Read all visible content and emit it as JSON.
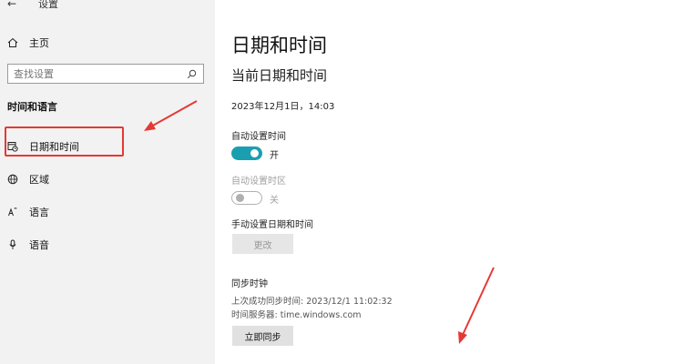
{
  "window": {
    "title": "设置"
  },
  "sidebar": {
    "home_label": "主页",
    "search_placeholder": "查找设置",
    "section_label": "时间和语言",
    "items": [
      {
        "label": "日期和时间",
        "icon": "calendar-clock-icon",
        "selected": true
      },
      {
        "label": "区域",
        "icon": "globe-icon"
      },
      {
        "label": "语言",
        "icon": "language-icon"
      },
      {
        "label": "语音",
        "icon": "microphone-icon"
      }
    ]
  },
  "main": {
    "title": "日期和时间",
    "current_heading": "当前日期和时间",
    "current_datetime": "2023年12月1日，14:03",
    "auto_time": {
      "label": "自动设置时间",
      "state": "开",
      "on": true
    },
    "auto_timezone": {
      "label": "自动设置时区",
      "state": "关",
      "on": false,
      "disabled": true
    },
    "manual": {
      "label": "手动设置日期和时间",
      "button": "更改"
    },
    "sync": {
      "heading": "同步时钟",
      "last_sync": "上次成功同步时间: 2023/12/1 11:02:32",
      "server": "时间服务器: time.windows.com",
      "button": "立即同步"
    }
  },
  "colors": {
    "accent": "#1a9fb0",
    "annotation": "#e53935",
    "sidebar_bg": "#f2f2f2"
  }
}
